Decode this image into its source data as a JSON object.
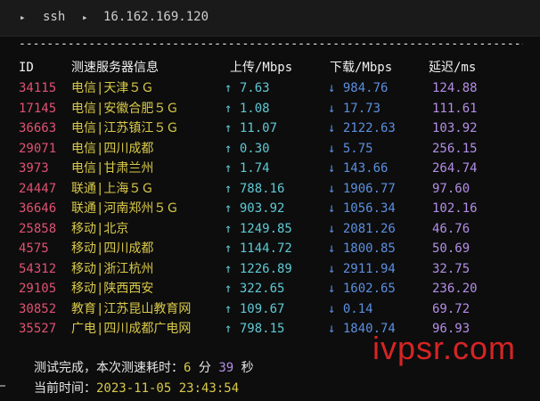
{
  "titlebar": {
    "prompt_arrow": "▸",
    "command": "ssh",
    "host_arrow": "▸",
    "host": "16.162.169.120"
  },
  "divider": "----------------------------------------------------------------------------------------",
  "header": {
    "id": "ID",
    "name": "测速服务器信息",
    "up": "上传/Mbps",
    "down": "下载/Mbps",
    "latency": "延迟/ms"
  },
  "rows": [
    {
      "id": "34115",
      "name": "电信|天津５Ｇ",
      "up": "↑ 7.63",
      "down": "↓ 984.76",
      "latency": "124.88"
    },
    {
      "id": "17145",
      "name": "电信|安徽合肥５Ｇ",
      "up": "↑ 1.08",
      "down": "↓ 17.73",
      "latency": "111.61"
    },
    {
      "id": "36663",
      "name": "电信|江苏镇江５Ｇ",
      "up": "↑ 11.07",
      "down": "↓ 2122.63",
      "latency": "103.92"
    },
    {
      "id": "29071",
      "name": "电信|四川成都",
      "up": "↑ 0.30",
      "down": "↓ 5.75",
      "latency": "256.15"
    },
    {
      "id": "3973",
      "name": "电信|甘肃兰州",
      "up": "↑ 1.74",
      "down": "↓ 143.66",
      "latency": "264.74"
    },
    {
      "id": "24447",
      "name": "联通|上海５Ｇ",
      "up": "↑ 788.16",
      "down": "↓ 1906.77",
      "latency": "97.60"
    },
    {
      "id": "36646",
      "name": "联通|河南郑州５Ｇ",
      "up": "↑ 903.92",
      "down": "↓ 1056.34",
      "latency": "102.16"
    },
    {
      "id": "25858",
      "name": "移动|北京",
      "up": "↑ 1249.85",
      "down": "↓ 2081.26",
      "latency": "46.76"
    },
    {
      "id": "4575",
      "name": "移动|四川成都",
      "up": "↑ 1144.72",
      "down": "↓ 1800.85",
      "latency": "50.69"
    },
    {
      "id": "54312",
      "name": "移动|浙江杭州",
      "up": "↑ 1226.89",
      "down": "↓ 2911.94",
      "latency": "32.75"
    },
    {
      "id": "29105",
      "name": "移动|陕西西安",
      "up": "↑ 322.65",
      "down": "↓ 1602.65",
      "latency": "236.20"
    },
    {
      "id": "30852",
      "name": "教育|江苏昆山教育网",
      "up": "↑ 109.67",
      "down": "↓ 0.14",
      "latency": "69.72"
    },
    {
      "id": "35527",
      "name": "广电|四川成都广电网",
      "up": "↑ 798.15",
      "down": "↓ 1840.74",
      "latency": "96.93"
    }
  ],
  "footer": {
    "done_label": "测试完成，本次测速耗时：",
    "minutes": "6",
    "min_unit": "分",
    "seconds": "39",
    "sec_unit": "秒",
    "time_label": "当前时间：",
    "time_value": "2023-11-05 23:43:54"
  },
  "watermark": "ivpsr.com",
  "colors": {
    "id": "#e05273",
    "name": "#d9c94a",
    "up": "#5fc9d4",
    "down": "#5b8fdf",
    "latency": "#b38ee6",
    "accent": "#d9c94a",
    "watermark": "#d72424"
  }
}
